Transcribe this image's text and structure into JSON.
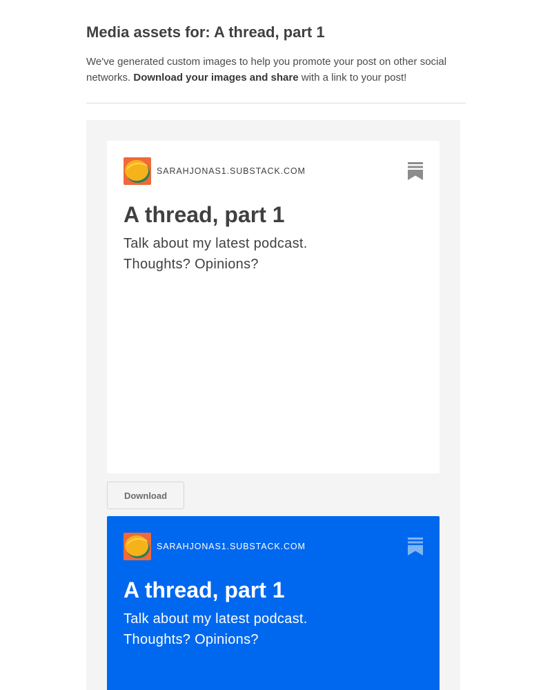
{
  "header": {
    "title": "Media assets for: A thread, part 1",
    "intro_text_before": "We've generated custom images to help you promote your post on other social networks. ",
    "intro_bold": "Download your images and share",
    "intro_text_after": " with a link to your post!"
  },
  "assets": [
    {
      "theme": "light",
      "background_color": "#ffffff",
      "domain": "SARAHJONAS1.SUBSTACK.COM",
      "logo_icon": "publication-logo",
      "brand_icon": "substack-bookmark-icon",
      "post_title": "A thread, part 1",
      "post_subtitle": "Talk about my latest podcast. Thoughts? Opinions?",
      "download_label": "Download"
    },
    {
      "theme": "blue",
      "background_color": "#0068ef",
      "domain": "SARAHJONAS1.SUBSTACK.COM",
      "logo_icon": "publication-logo",
      "brand_icon": "substack-bookmark-icon",
      "post_title": "A thread, part 1",
      "post_subtitle": "Talk about my latest podcast. Thoughts? Opinions?"
    }
  ],
  "colors": {
    "accent_blue": "#0068ef",
    "panel_gray": "#f4f4f4",
    "text_dark": "#404040"
  }
}
